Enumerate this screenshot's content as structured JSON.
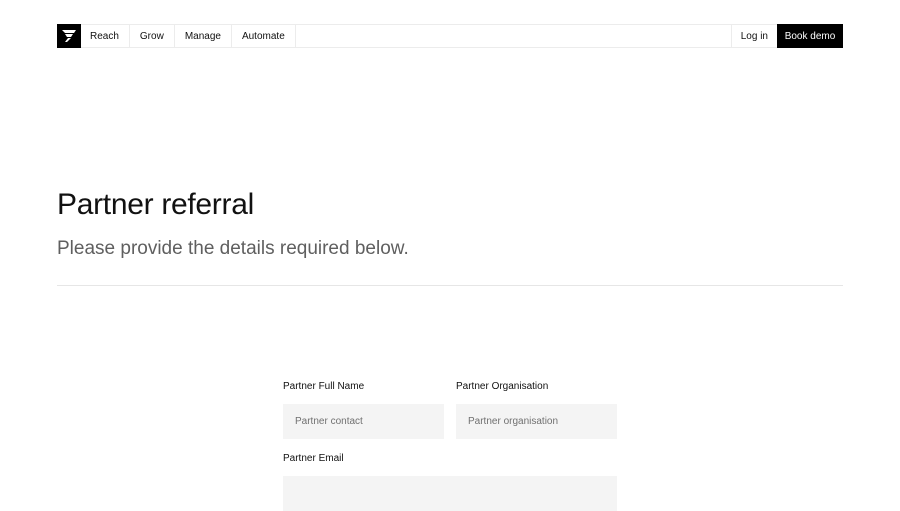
{
  "nav": {
    "items": [
      "Reach",
      "Grow",
      "Manage",
      "Automate"
    ],
    "login_label": "Log in",
    "demo_label": "Book demo"
  },
  "hero": {
    "title": "Partner referral",
    "subtitle": "Please provide the details required below."
  },
  "form": {
    "full_name": {
      "label": "Partner Full Name",
      "placeholder": "Partner contact",
      "value": ""
    },
    "organisation": {
      "label": "Partner Organisation",
      "placeholder": "Partner organisation",
      "value": ""
    },
    "email": {
      "label": "Partner Email",
      "placeholder": "",
      "value": ""
    }
  },
  "colors": {
    "accent": "#000000",
    "subtitle": "#5f5f5f",
    "input_bg": "#f4f4f4",
    "border": "#ececec"
  },
  "icons": {
    "logo": "brand-logo-icon"
  }
}
